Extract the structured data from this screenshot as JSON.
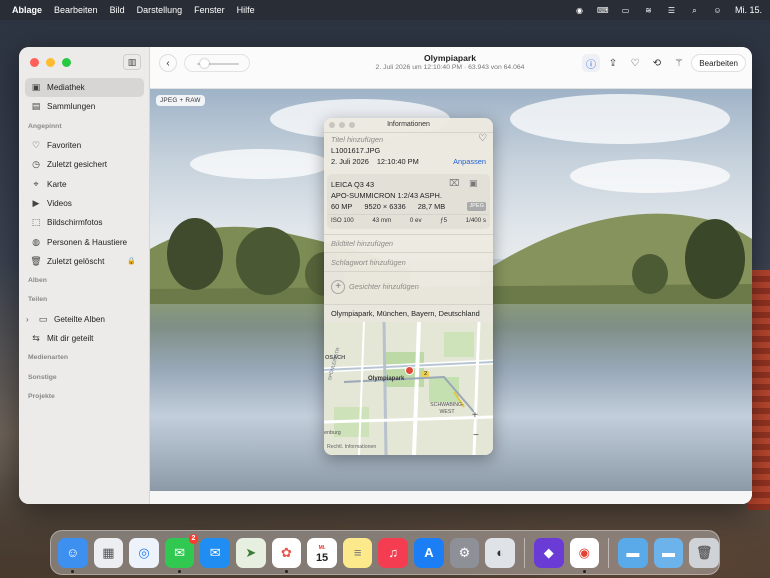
{
  "menubar": {
    "items": [
      "Ablage",
      "Bearbeiten",
      "Bild",
      "Darstellung",
      "Fenster",
      "Hilfe"
    ],
    "clock": "Mi. 15."
  },
  "sidebar": {
    "library_items": [
      {
        "label": "Mediathek",
        "icon": "photo-library-icon"
      },
      {
        "label": "Sammlungen",
        "icon": "collections-icon"
      }
    ],
    "pinned_header": "Angepinnt",
    "pinned_items": [
      {
        "label": "Favoriten",
        "icon": "heart-icon"
      },
      {
        "label": "Zuletzt gesichert",
        "icon": "clock-icon"
      },
      {
        "label": "Karte",
        "icon": "map-icon"
      },
      {
        "label": "Videos",
        "icon": "video-icon"
      },
      {
        "label": "Bildschirmfotos",
        "icon": "screenshot-icon"
      },
      {
        "label": "Personen & Haustiere",
        "icon": "person-icon"
      },
      {
        "label": "Zuletzt gelöscht",
        "icon": "trash-icon"
      }
    ],
    "albums_header": "Alben",
    "shared_header": "Teilen",
    "shared_items": [
      {
        "label": "Geteilte Alben",
        "icon": "shared-album-icon"
      },
      {
        "label": "Mit dir geteilt",
        "icon": "shared-with-you-icon"
      }
    ],
    "media_types_header": "Medienarten",
    "other_header": "Sonstige",
    "projects_header": "Projekte"
  },
  "toolbar": {
    "title": "Olympiapark",
    "subtitle": "2. Juli 2026 um 12:10:40 PM  ·  63.943 von 64.064",
    "edit_label": "Bearbeiten"
  },
  "photo": {
    "format_badge": "JPEG + RAW"
  },
  "info": {
    "panel_title": "Informationen",
    "title_placeholder": "Titel hinzufügen",
    "filename": "L1001617.JPG",
    "date": "2. Juli 2026",
    "time": "12:10:40 PM",
    "adjust_label": "Anpassen",
    "camera": "LEICA Q3 43",
    "lens": "APO-SUMMICRON 1:2/43 ASPH.",
    "megapixels": "60 MP",
    "resolution": "9520 × 6336",
    "filesize": "28,7 MB",
    "format": "JPEG",
    "iso": "ISO 100",
    "focal": "43 mm",
    "ev": "0 ev",
    "aperture": "ƒ5",
    "shutter": "1/400 s",
    "caption_placeholder": "Bildtitel hinzufügen",
    "keyword_placeholder": "Schlagwort hinzufügen",
    "faces_label": "Gesichter hinzufügen",
    "location": "Olympiapark, München, Bayern, Deutschland",
    "map_labels": {
      "poi": "Olympiapark",
      "district1": "OSACH",
      "district2": "SCHWABING-WEST",
      "district3": "enburg",
      "street": "SPÖNLEINSTR",
      "legal": "Rechtl. Informationen",
      "road_badge": "2"
    }
  },
  "dock": {
    "messages_badge": "2",
    "calendar_day": "15",
    "calendar_month": "MI."
  }
}
